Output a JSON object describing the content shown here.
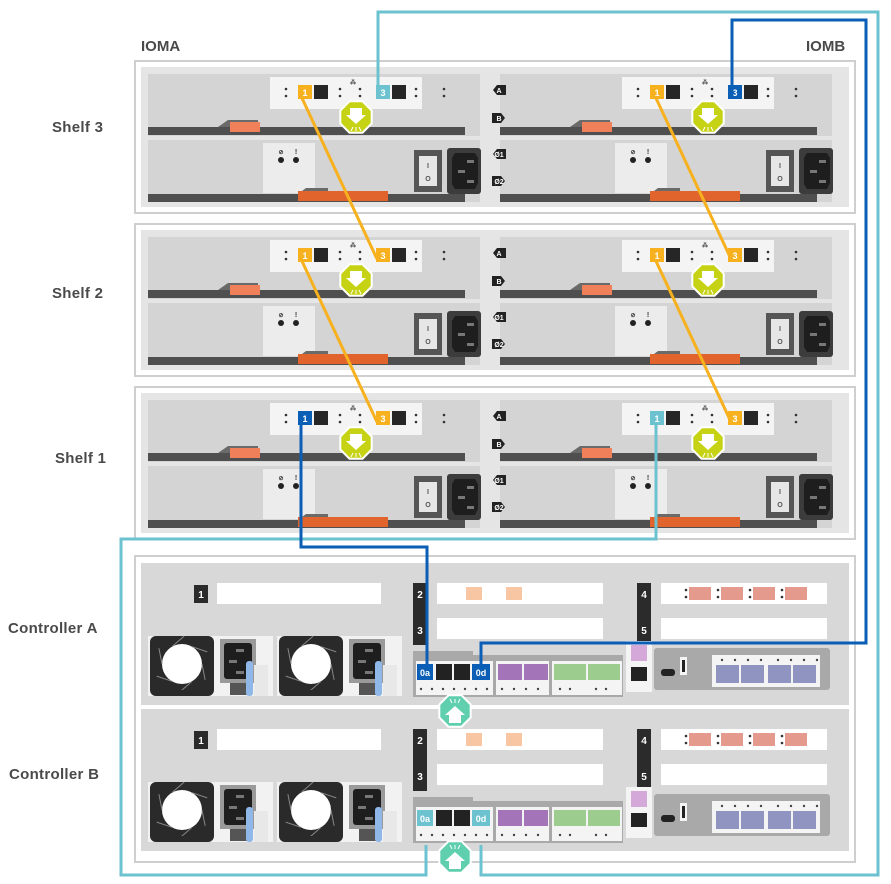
{
  "iom_labels": {
    "left": "IOMA",
    "right": "IOMB"
  },
  "row_labels": {
    "shelf3": "Shelf 3",
    "shelf2": "Shelf 2",
    "shelf1": "Shelf 1",
    "controller_a": "Controller A",
    "controller_b": "Controller B"
  },
  "shelf_port_labels": {
    "port1": "1",
    "port3": "3"
  },
  "shelf_side_badges": [
    "A",
    "B",
    "Ø1",
    "Ø2"
  ],
  "controller_slot_labels": [
    "1",
    "2",
    "3",
    "4",
    "5"
  ],
  "controller_port_labels": {
    "port_0a": "0a",
    "port_0d": "0d"
  },
  "colors": {
    "cable_shelf_chain": "#f7b11e",
    "cable_dark_blue": "#0a5eb5",
    "cable_light_blue": "#6cc2cf",
    "shelf_attention": "#c6d315",
    "controller_attention": "#5fcfae",
    "chassis": "#d8d8d8",
    "handle_orange": "#f0805a"
  },
  "cables": [
    {
      "from": "Controller A 0a",
      "to": "Shelf 1 IOMA port 1",
      "color": "dark-blue"
    },
    {
      "from": "Controller A 0d",
      "to": "Shelf 3 IOMB port 3",
      "color": "dark-blue"
    },
    {
      "from": "Controller B 0a",
      "to": "Shelf 1 IOMB port 1",
      "color": "light-blue"
    },
    {
      "from": "Controller B 0d",
      "to": "Shelf 3 IOMA port 3",
      "color": "light-blue"
    },
    {
      "from": "Shelf 1 IOMA port 3",
      "to": "Shelf 2 IOMA port 1",
      "color": "orange"
    },
    {
      "from": "Shelf 2 IOMA port 3",
      "to": "Shelf 3 IOMA port 1",
      "color": "orange"
    },
    {
      "from": "Shelf 1 IOMB port 3",
      "to": "Shelf 2 IOMB port 1",
      "color": "orange"
    },
    {
      "from": "Shelf 2 IOMB port 3",
      "to": "Shelf 3 IOMB port 1",
      "color": "orange"
    }
  ]
}
